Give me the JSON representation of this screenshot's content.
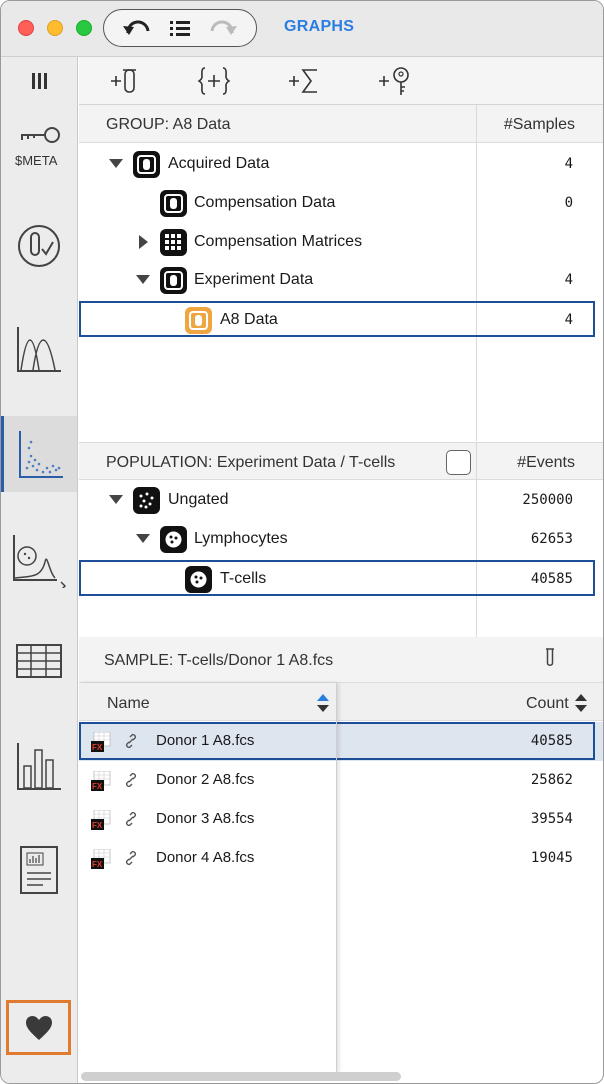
{
  "titlebar": {
    "title": "GRAPHS"
  },
  "sidebar": {
    "meta_label": "$META"
  },
  "group": {
    "title": "GROUP: A8 Data",
    "column": "#Samples",
    "rows": [
      {
        "label": "Acquired Data",
        "count": "4"
      },
      {
        "label": "Compensation Data",
        "count": "0"
      },
      {
        "label": "Compensation Matrices",
        "count": ""
      },
      {
        "label": "Experiment Data",
        "count": "4"
      },
      {
        "label": "A8 Data",
        "count": "4"
      }
    ]
  },
  "population": {
    "title": "POPULATION: Experiment Data / T-cells",
    "column": "#Events",
    "rows": [
      {
        "label": "Ungated",
        "count": "250000"
      },
      {
        "label": "Lymphocytes",
        "count": "62653"
      },
      {
        "label": "T-cells",
        "count": "40585"
      }
    ]
  },
  "sample": {
    "title": "SAMPLE: T-cells/Donor 1 A8.fcs",
    "name_header": "Name",
    "count_header": "Count",
    "rows": [
      {
        "name": "Donor 1 A8.fcs",
        "count": "40585"
      },
      {
        "name": "Donor 2 A8.fcs",
        "count": "25862"
      },
      {
        "name": "Donor 3 A8.fcs",
        "count": "39554"
      },
      {
        "name": "Donor 4 A8.fcs",
        "count": "19045"
      }
    ]
  },
  "colors": {
    "accent": "#2a7de1",
    "selection": "#1d4f99",
    "favorite_border": "#e07a2e"
  }
}
